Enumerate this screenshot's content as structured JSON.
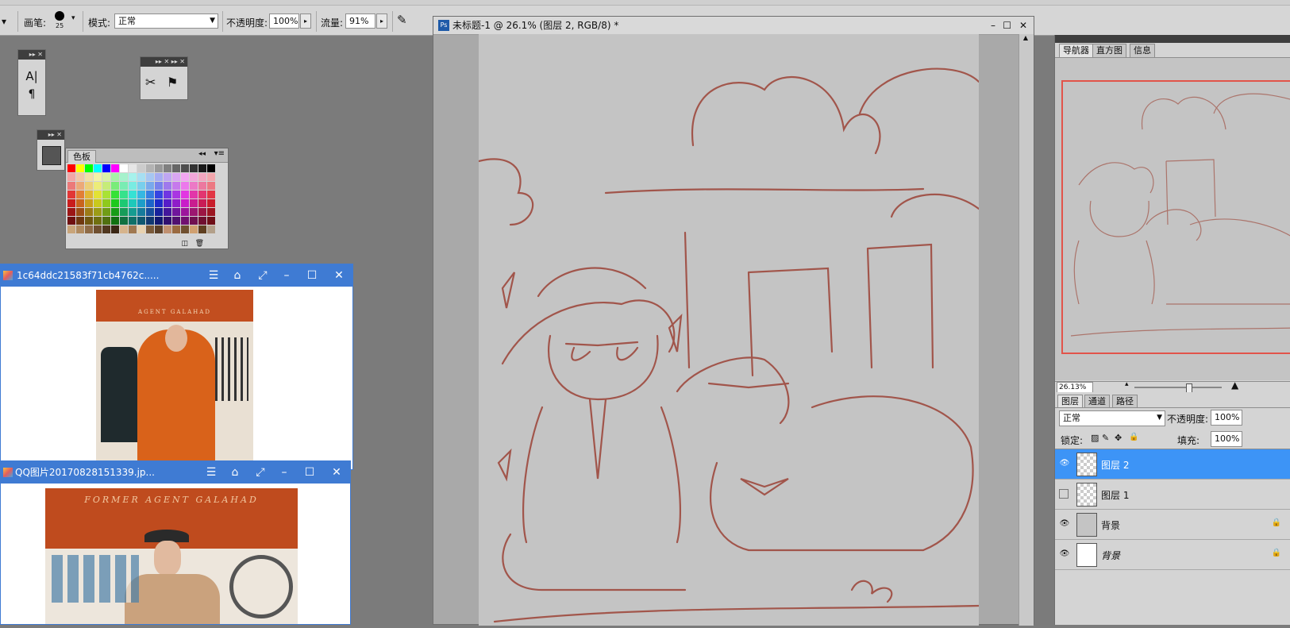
{
  "options_bar": {
    "brush_label": "画笔:",
    "brush_size": "25",
    "mode_label": "模式:",
    "mode_value": "正常",
    "opacity_label": "不透明度:",
    "opacity_value": "100%",
    "flow_label": "流量:",
    "flow_value": "91%"
  },
  "swatches": {
    "tab_label": "色板"
  },
  "viewer1": {
    "title": "1c64ddc21583f71cb4762c.....",
    "poster_text": "AGENT GALAHAD"
  },
  "viewer2": {
    "title": "QQ图片20170828151339.jp...",
    "poster_text": "FORMER AGENT GALAHAD"
  },
  "document": {
    "title": "未标题-1 @ 26.1% (图层 2, RGB/8) *"
  },
  "navigator": {
    "tabs": [
      "导航器",
      "直方图",
      "信息"
    ],
    "zoom": "26.13%"
  },
  "layers_panel": {
    "tabs": [
      "图层",
      "通道",
      "路径"
    ],
    "blend_mode": "正常",
    "opacity_label": "不透明度:",
    "opacity_value": "100%",
    "lock_label": "锁定:",
    "fill_label": "填充:",
    "fill_value": "100%",
    "layers": [
      {
        "name": "图层 2",
        "visible": true,
        "selected": true
      },
      {
        "name": "图层 1",
        "visible": false,
        "selected": false
      },
      {
        "name": "背景",
        "visible": true,
        "selected": false
      },
      {
        "name": "背景",
        "visible": true,
        "selected": false
      }
    ]
  },
  "colors": {
    "selected_layer": "#3d94f6",
    "viewer_title": "#3f7bd3",
    "sketch_stroke": "#9e4a3e"
  }
}
